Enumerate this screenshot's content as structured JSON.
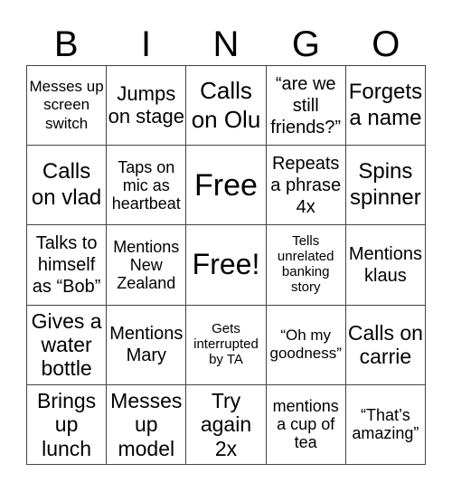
{
  "header": {
    "letters": [
      "B",
      "I",
      "N",
      "G",
      "O"
    ]
  },
  "grid": {
    "rows": [
      [
        "Messes up screen switch",
        "Jumps on stage",
        "Calls on Olu",
        "“are we still friends?”",
        "Forgets a name"
      ],
      [
        "Calls on vlad",
        "Taps on mic as heartbeat",
        "Free",
        "Repeats a phrase 4x",
        "Spins spinner"
      ],
      [
        "Talks to himself as “Bob”",
        "Mentions New Zealand",
        "Free!",
        "Tells unrelated banking story",
        "Mentions klaus"
      ],
      [
        "Gives a water bottle",
        "Mentions Mary",
        "Gets interrupted by TA",
        "“Oh my goodness”",
        "Calls on carrie"
      ],
      [
        "Brings up lunch",
        "Messes up model",
        "Try again 2x",
        "mentions a cup of tea",
        "“That’s amazing”"
      ]
    ]
  }
}
